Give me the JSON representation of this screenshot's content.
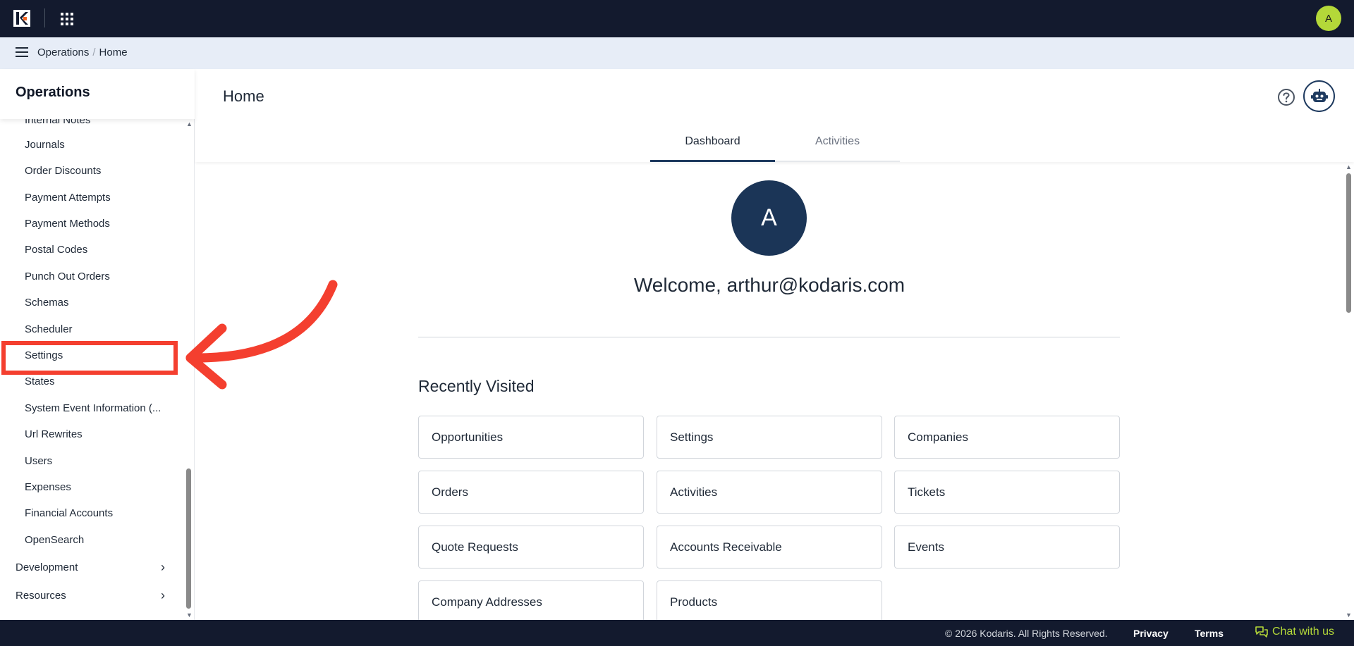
{
  "topbar": {
    "logo_icon": "kodaris-logo-icon",
    "apps_icon": "apps-grid-icon",
    "avatar_initial": "A"
  },
  "breadcrumb": {
    "items": [
      "Operations",
      "Home"
    ],
    "separator": "/"
  },
  "sidebar": {
    "title": "Operations",
    "items": [
      {
        "label": "Internal Notes"
      },
      {
        "label": "Journals"
      },
      {
        "label": "Order Discounts"
      },
      {
        "label": "Payment Attempts"
      },
      {
        "label": "Payment Methods"
      },
      {
        "label": "Postal Codes"
      },
      {
        "label": "Punch Out Orders"
      },
      {
        "label": "Schemas"
      },
      {
        "label": "Scheduler"
      },
      {
        "label": "Settings"
      },
      {
        "label": "States"
      },
      {
        "label": "System Event Information (..."
      },
      {
        "label": "Url Rewrites"
      },
      {
        "label": "Users"
      },
      {
        "label": "Expenses"
      },
      {
        "label": "Financial Accounts"
      },
      {
        "label": "OpenSearch"
      }
    ],
    "groups": [
      {
        "label": "Development",
        "chevron": "›"
      },
      {
        "label": "Resources",
        "chevron": "›"
      }
    ]
  },
  "main": {
    "title": "Home",
    "tabs": [
      {
        "label": "Dashboard",
        "active": true
      },
      {
        "label": "Activities",
        "active": false
      }
    ],
    "avatar_initial": "A",
    "welcome": "Welcome, arthur@kodaris.com",
    "recent_title": "Recently Visited",
    "recent_cards": [
      {
        "label": "Opportunities"
      },
      {
        "label": "Settings"
      },
      {
        "label": "Companies"
      },
      {
        "label": "Orders"
      },
      {
        "label": "Activities"
      },
      {
        "label": "Tickets"
      },
      {
        "label": "Quote Requests"
      },
      {
        "label": "Accounts Receivable"
      },
      {
        "label": "Events"
      },
      {
        "label": "Company Addresses"
      },
      {
        "label": "Products"
      }
    ]
  },
  "footer": {
    "copyright": "© 2026 Kodaris. All Rights Reserved.",
    "privacy": "Privacy",
    "terms": "Terms",
    "chat": "Chat with us"
  },
  "colors": {
    "topbar_bg": "#131a2e",
    "accent_green": "#b4d839",
    "navy": "#1b3557",
    "annotation_red": "#f43f2f",
    "crumb_bg": "#e7edf7"
  }
}
